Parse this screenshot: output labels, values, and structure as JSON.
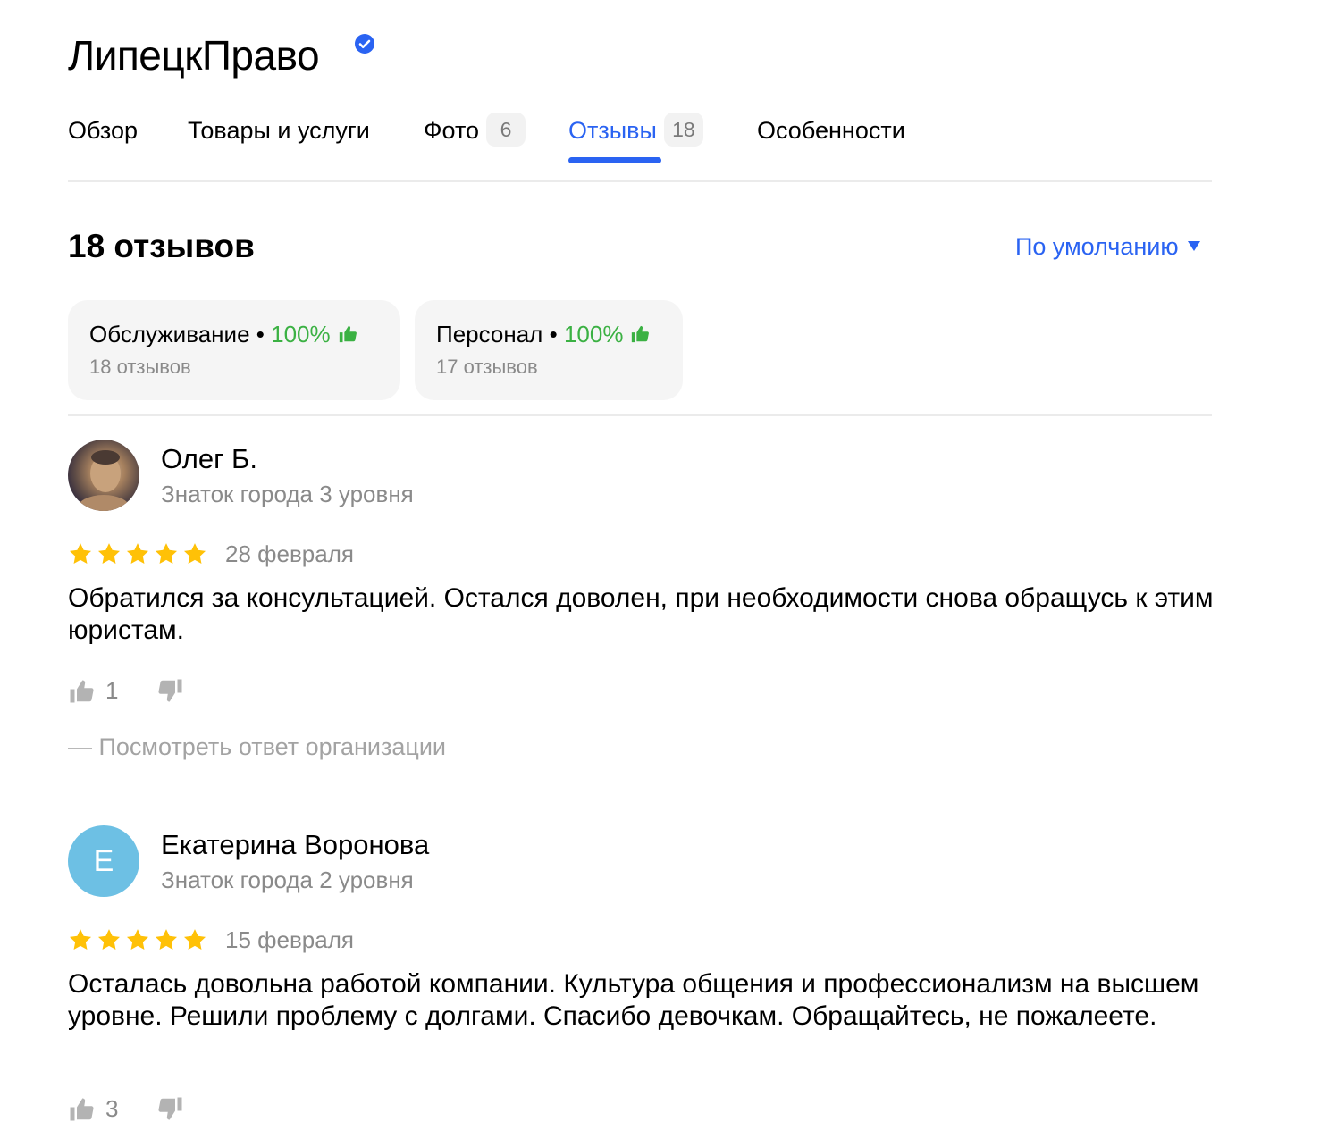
{
  "org": {
    "name": "ЛипецкПраво",
    "verified_icon": "verified-check-icon"
  },
  "tabs": [
    {
      "label": "Обзор",
      "count": null,
      "active": false
    },
    {
      "label": "Товары и услуги",
      "count": null,
      "active": false
    },
    {
      "label": "Фото",
      "count": "6",
      "active": false
    },
    {
      "label": "Отзывы",
      "count": "18",
      "active": true
    },
    {
      "label": "Особенности",
      "count": null,
      "active": false
    }
  ],
  "reviews_heading": "18 отзывов",
  "sort": {
    "label": "По умолчанию",
    "icon": "triangle-down-icon"
  },
  "aspects": [
    {
      "name": "Обслуживание",
      "percent": "100%",
      "count": "18 отзывов"
    },
    {
      "name": "Персонал",
      "percent": "100%",
      "count": "17 отзывов"
    }
  ],
  "aspect_separator": "•",
  "reviews": [
    {
      "author": "Олег Б.",
      "level": "Знаток города 3 уровня",
      "avatar": "photo",
      "rating": 5,
      "date": "28 февраля",
      "text": "Обратился за консультацией. Остался доволен, при необходимости снова обращусь к этим юристам.",
      "likes": "1",
      "reply_link": "— Посмотреть ответ организации"
    },
    {
      "author": "Екатерина Воронова",
      "level": "Знаток города 2 уровня",
      "avatar_letter": "Е",
      "rating": 5,
      "date": "15 февраля",
      "text": "Осталась довольна работой компании. Культура общения и профессионализм на высшем уровне. Решили проблему с долгами. Спасибо девочкам. Обращайтесь, не пожалеете.",
      "likes": "3"
    }
  ],
  "colors": {
    "accent": "#2a63f2",
    "positive": "#3bb143",
    "star": "#ffc107",
    "muted": "#8a8a8a"
  }
}
